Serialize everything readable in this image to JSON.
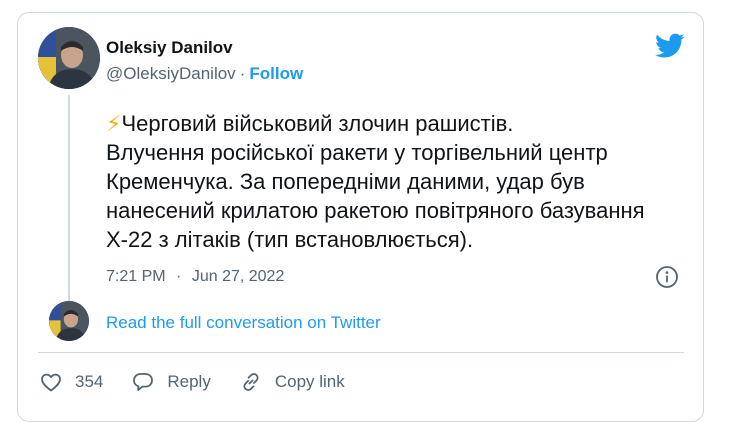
{
  "colors": {
    "accent": "#1d9bf0",
    "text": "#0f1419",
    "secondary": "#536471",
    "border": "#cfd9de",
    "bolt": "#f6b01e"
  },
  "author": {
    "name": "Oleksiy Danilov",
    "handle": "@OleksiyDanilov",
    "separator": "·",
    "follow_label": "Follow"
  },
  "tweet": {
    "emoji": "⚡",
    "text": "Черговий військовий злочин рашистів.\nВлучення російської ракети у торгівельний центр Кременчука. За попередніми даними, удар був нанесений крилатою ракетою повітряного базування Х-22 з літаків (тип встановлюється).",
    "time": "7:21 PM",
    "separator": "·",
    "date": "Jun 27, 2022"
  },
  "thread": {
    "read_more_label": "Read the full conversation on Twitter"
  },
  "actions": {
    "like_count": "354",
    "reply_label": "Reply",
    "copy_link_label": "Copy link"
  },
  "icons": {
    "brand": "twitter-bird-icon",
    "info": "info-icon",
    "like": "heart-icon",
    "reply": "speech-bubble-icon",
    "copy": "link-icon"
  }
}
